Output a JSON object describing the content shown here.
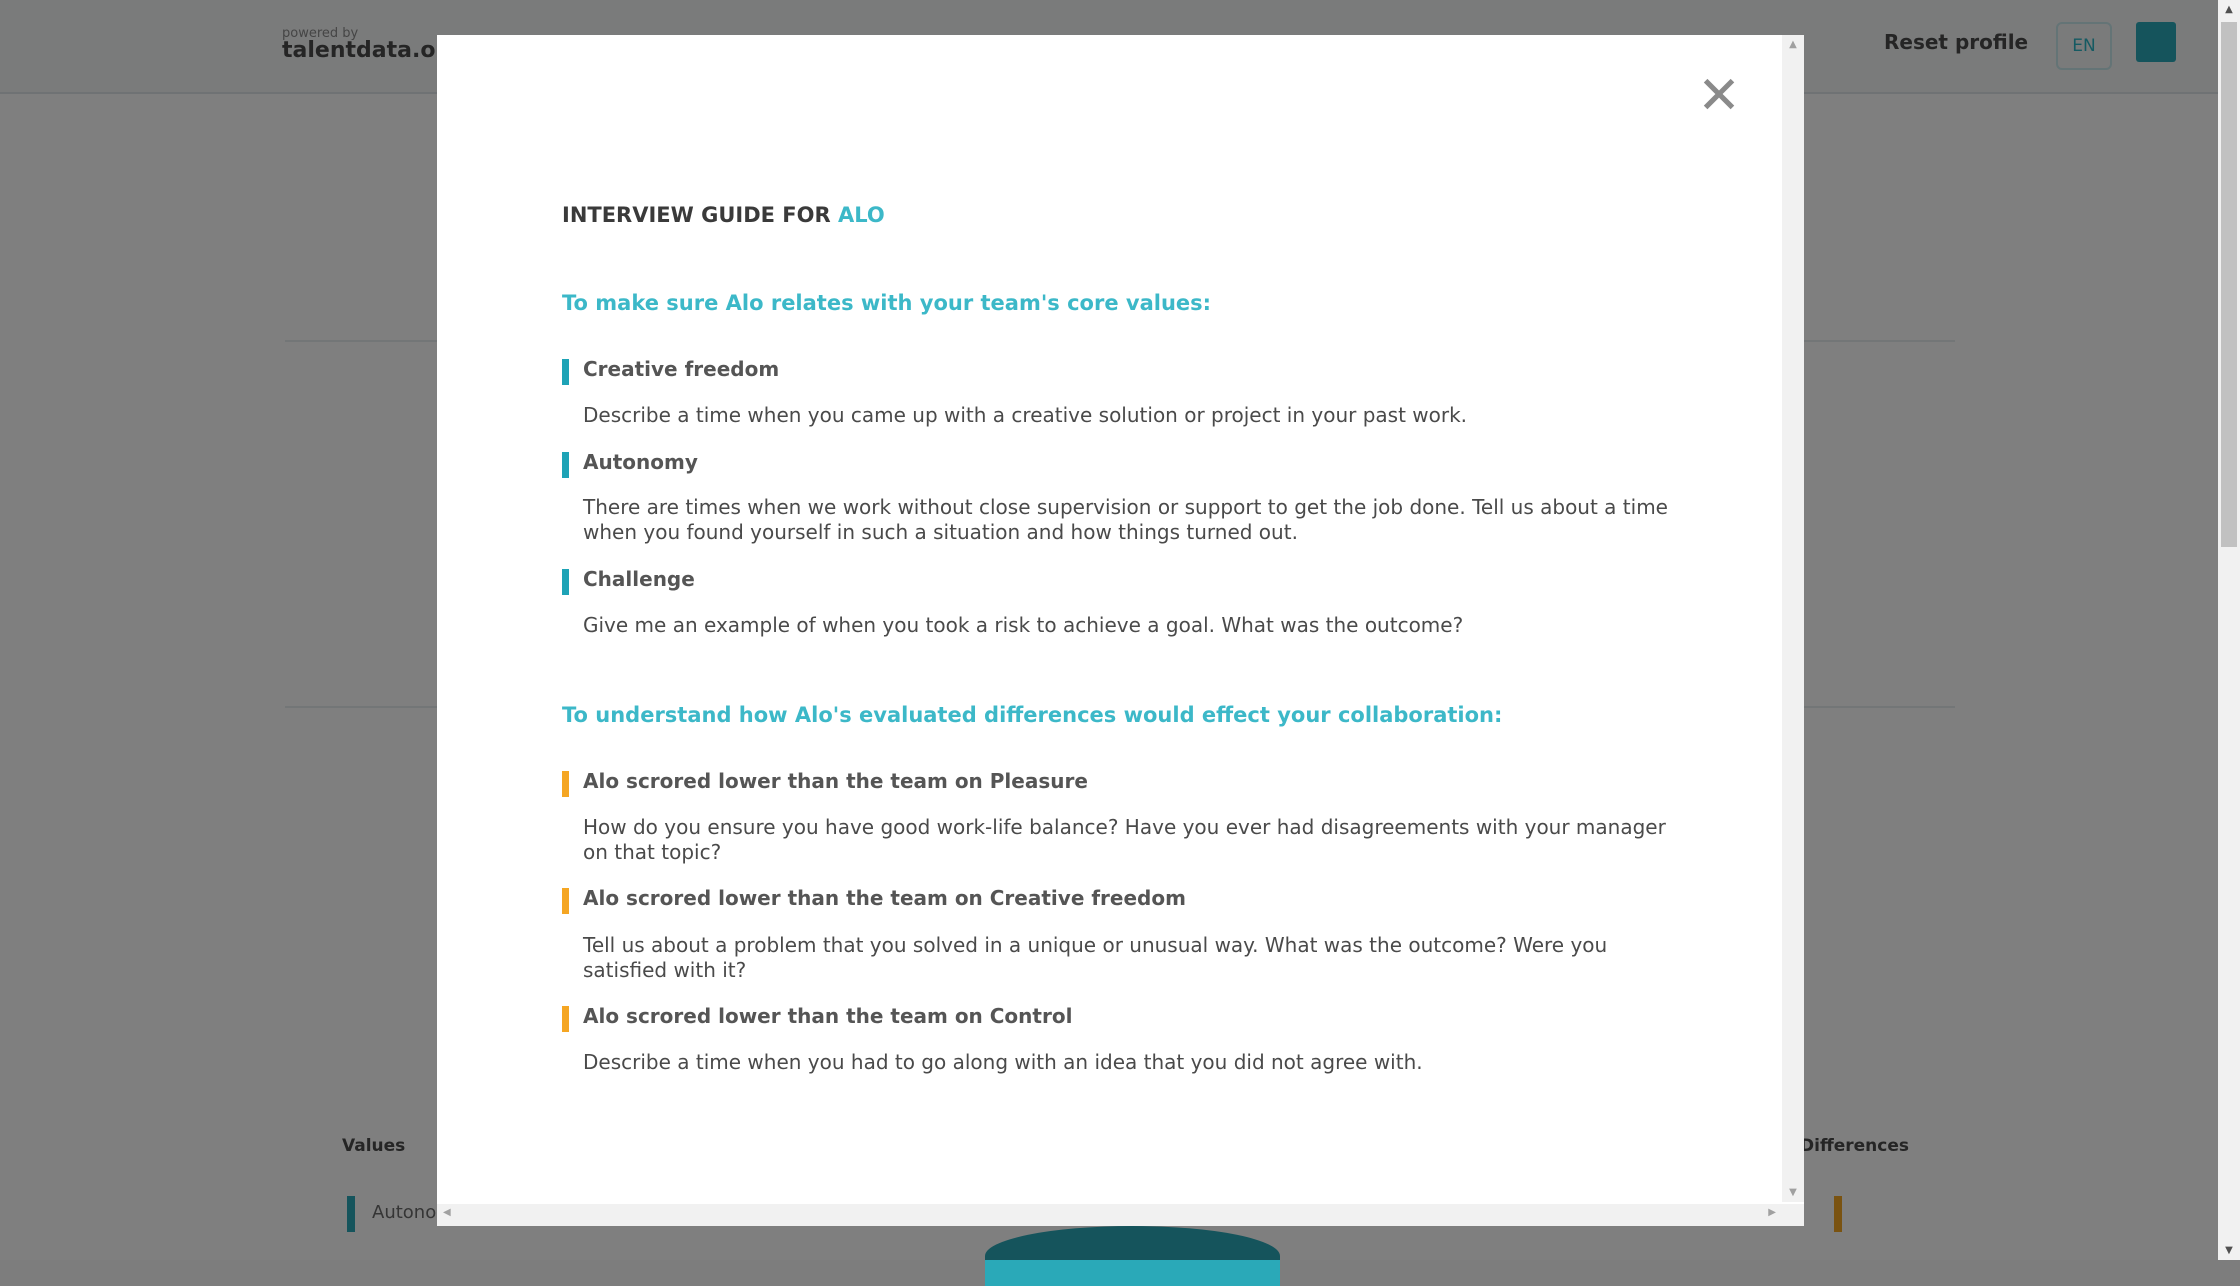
{
  "background": {
    "logo_small": "powered by",
    "logo": "talentdata.org",
    "reset_label": "Reset profile",
    "lang_label": "EN",
    "section_left": "Values",
    "section_right": "Differences",
    "item_left": "Autonomy"
  },
  "modal": {
    "title_prefix": "INTERVIEW GUIDE FOR ",
    "candidate_name": "ALO",
    "close_icon": "close-icon",
    "values_section": {
      "heading": "To make sure Alo relates with your team's core values:",
      "items": [
        {
          "title": "Creative freedom",
          "text": "Describe a time when you came up with a creative solution or project in your past work."
        },
        {
          "title": "Autonomy",
          "text": "There are times when we work without close supervision or support to get the job done. Tell us about a time when you found yourself in such a situation and how things turned out."
        },
        {
          "title": "Challenge",
          "text": "Give me an example of when you took a risk to achieve a goal. What was the outcome?"
        }
      ]
    },
    "differences_section": {
      "heading": "To understand how Alo's evaluated differences would effect your collaboration:",
      "items": [
        {
          "title": "Alo scrored lower than the team on Pleasure",
          "text": "How do you ensure you have good work-life balance? Have you ever had disagreements with your manager on that topic?"
        },
        {
          "title": "Alo scrored lower than the team on Creative freedom",
          "text": "Tell us about a problem that you solved in a unique or unusual way. What was the outcome? Were you satisfied with it?"
        },
        {
          "title": "Alo scrored lower than the team on Control",
          "text": "Describe a time when you had to go along with an idea that you did not agree with."
        }
      ]
    }
  },
  "colors": {
    "accent": "#3cb8c8",
    "values_marker": "#1ea3b6",
    "differences_marker": "#f5a623"
  }
}
